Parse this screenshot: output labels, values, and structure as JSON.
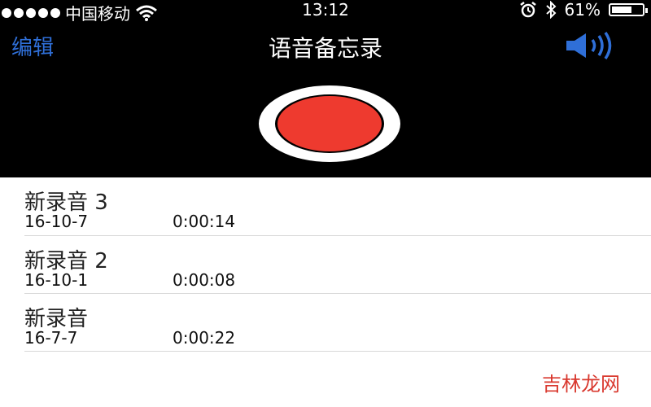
{
  "status_bar": {
    "carrier": "中国移动",
    "time": "13:12",
    "battery": "61%"
  },
  "nav": {
    "edit_label": "编辑",
    "title": "语音备忘录"
  },
  "recordings": [
    {
      "name": "新录音 3",
      "date": "16-10-7",
      "duration": "0:00:14"
    },
    {
      "name": "新录音 2",
      "date": "16-10-1",
      "duration": "0:00:08"
    },
    {
      "name": "新录音",
      "date": "16-7-7",
      "duration": "0:00:22"
    }
  ],
  "watermark": "吉林龙网",
  "colors": {
    "accent": "#2f6fd8",
    "record": "#ee3a2f",
    "background_top": "#000000"
  },
  "icons": [
    "signal-dots-icon",
    "wifi-icon",
    "alarm-icon",
    "bluetooth-icon",
    "battery-icon",
    "speaker-icon",
    "record-icon"
  ]
}
